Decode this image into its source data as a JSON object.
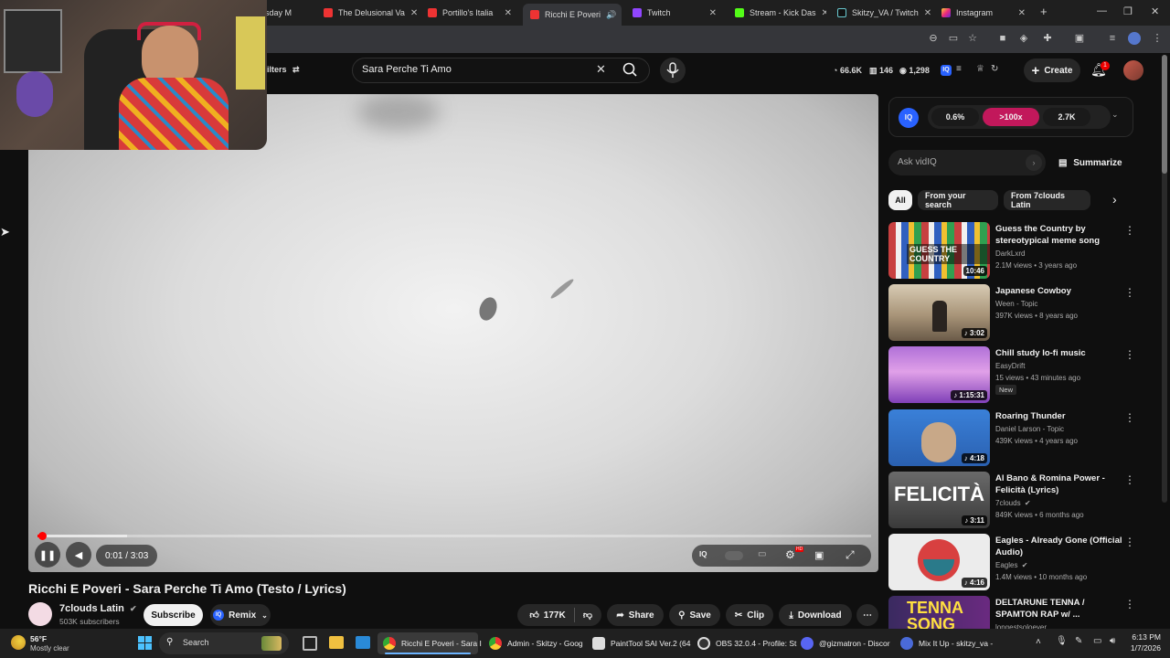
{
  "browser": {
    "tabs": [
      {
        "label": "sday M",
        "icon": "pin-tab-icon"
      },
      {
        "label": "The Delusional Va",
        "icon": "youtube-icon"
      },
      {
        "label": "Portillo's Italia",
        "icon": "youtube-icon"
      },
      {
        "label": "Ricchi E Poveri",
        "icon": "youtube-icon",
        "active": true
      },
      {
        "label": "Twitch",
        "icon": "twitch-icon"
      },
      {
        "label": "Stream - Kick Das",
        "icon": "kick-icon"
      },
      {
        "label": "Skitzy_VA / Twitch",
        "icon": "tiktok-icon"
      },
      {
        "label": "Instagram",
        "icon": "instagram-icon"
      }
    ],
    "new_tab": "+",
    "close_x": "✕"
  },
  "youtube": {
    "filters_label": "ilters",
    "search_query": "Sara Perche Ti Amo",
    "stats": {
      "views": "66.6K",
      "likes": "146",
      "eye": "1,298"
    },
    "create_label": "Create",
    "notif_count": "1"
  },
  "player": {
    "time": "0:01 / 3:03",
    "progress_fraction": 0.006,
    "buffered_fraction": 0.107,
    "iq_label": "IQ",
    "hd_label": "HD"
  },
  "video": {
    "title": "Ricchi E Poveri - Sara Perche Ti Amo (Testo / Lyrics)",
    "channel": "7clouds Latin",
    "subscribers": "503K subscribers",
    "subscribe_label": "Subscribe",
    "remix_label": "Remix",
    "likes": "177K",
    "share_label": "Share",
    "save_label": "Save",
    "clip_label": "Clip",
    "download_label": "Download"
  },
  "vidiq": {
    "logo": "IQ",
    "score1": "0.6%",
    "score2": ">100x",
    "score3": "2.7K",
    "ask_placeholder": "Ask vidIQ",
    "summarize_label": "Summarize"
  },
  "chips": [
    "All",
    "From your search",
    "From 7clouds Latin"
  ],
  "recommendations": [
    {
      "title": "Guess the Country by stereotypical meme song",
      "channel": "DarkLxrd",
      "meta": "2.1M views • 3 years ago",
      "duration": "10:46",
      "thumb_color": "#6b7fa8"
    },
    {
      "title": "Japanese Cowboy",
      "channel": "Ween - Topic",
      "meta": "397K views • 8 years ago",
      "duration": "♪ 3:02",
      "thumb_color": "#8a7560"
    },
    {
      "title": "Chill study lo-fi music",
      "channel": "EasyDrift",
      "meta": "15 views • 43 minutes ago",
      "duration": "♪ 1:15:31",
      "badge": "New",
      "thumb_color": "#a050c8"
    },
    {
      "title": "Roaring Thunder",
      "channel": "Daniel Larson - Topic",
      "meta": "439K views • 4 years ago",
      "duration": "♪ 4:18",
      "thumb_color": "#2e6fc0"
    },
    {
      "title": "Al Bano & Romina Power - Felicità (Lyrics)",
      "channel": "7clouds",
      "meta": "849K views • 6 months ago",
      "duration": "♪ 3:11",
      "thumb_text": "FELICITÀ",
      "thumb_color": "#5a5a5a"
    },
    {
      "title": "Eagles - Already Gone (Official Audio)",
      "channel": "Eagles",
      "meta": "1.4M views • 10 months ago",
      "duration": "♪ 4:16",
      "thumb_color": "#e8e8e8"
    },
    {
      "title": "DELTARUNE TENNA / SPAMTON RAP w/ ...",
      "channel": "longestsoloever",
      "meta": "",
      "duration": "",
      "thumb_text": "TENNA SONG",
      "thumb_color": "#3a2a60"
    }
  ],
  "taskbar": {
    "weather_temp": "56°F",
    "weather_desc": "Mostly clear",
    "search_label": "Search",
    "apps": [
      {
        "label": "Ricchi E Poveri - Sara I",
        "icon": "chrome-icon",
        "active": true
      },
      {
        "label": "Admin - Skitzy - Goog",
        "icon": "chrome-icon"
      },
      {
        "label": "PaintTool SAI Ver.2 (64",
        "icon": "painttool-icon"
      },
      {
        "label": "OBS 32.0.4 - Profile: St",
        "icon": "obs-icon"
      },
      {
        "label": "@gizmatron - Discor",
        "icon": "discord-icon"
      },
      {
        "label": "Mix It Up - skitzy_va -",
        "icon": "mixitup-icon"
      }
    ],
    "time": "6:13 PM",
    "date": "1/7/2026"
  }
}
